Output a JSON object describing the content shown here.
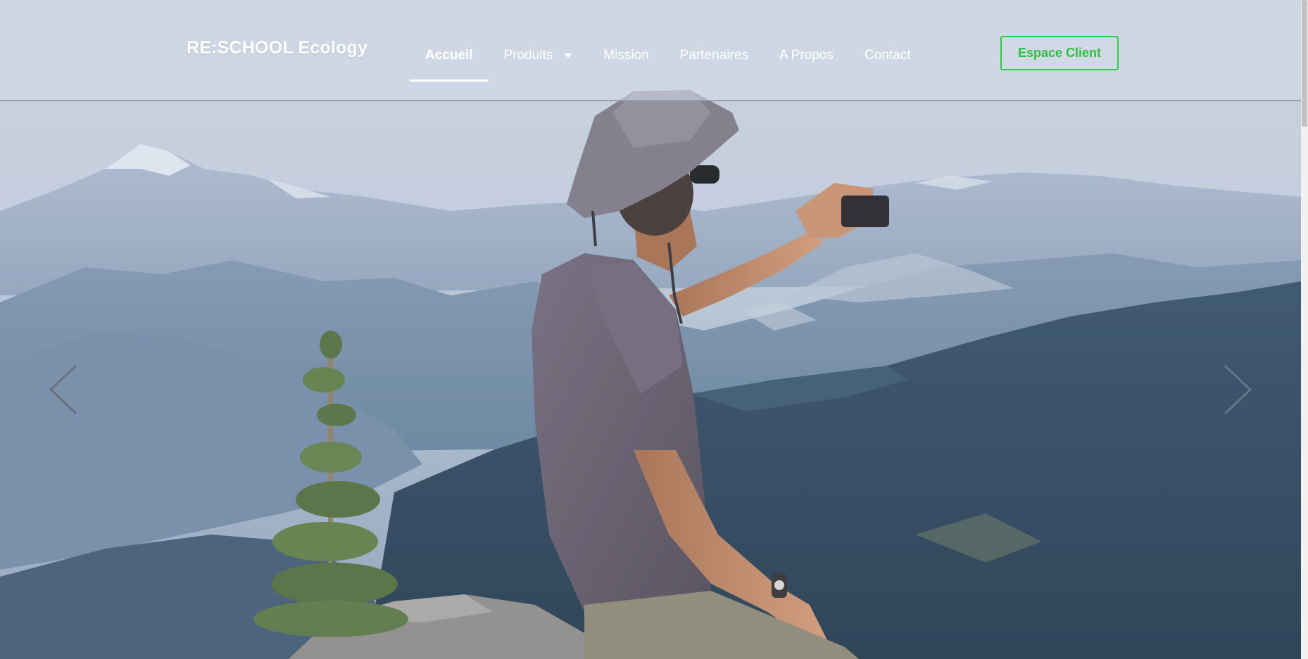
{
  "brand": {
    "name": "RE:SCHOOL Ecology"
  },
  "nav": {
    "items": [
      {
        "label": "Accueil",
        "active": true
      },
      {
        "label": "Produits",
        "has_dropdown": true
      },
      {
        "label": "Mission"
      },
      {
        "label": "Partenaires"
      },
      {
        "label": "A Propos"
      },
      {
        "label": "Contact"
      }
    ]
  },
  "cta": {
    "label": "Espace Client",
    "color": "#2ecc40"
  },
  "carousel": {
    "prev_icon": "chevron-left-icon",
    "next_icon": "chevron-right-icon",
    "slide_image": "hiker-photographing-mountains"
  },
  "colors": {
    "accent_green": "#2ecc40",
    "header_overlay": "#d6dde9",
    "nav_text": "#ffffff"
  }
}
